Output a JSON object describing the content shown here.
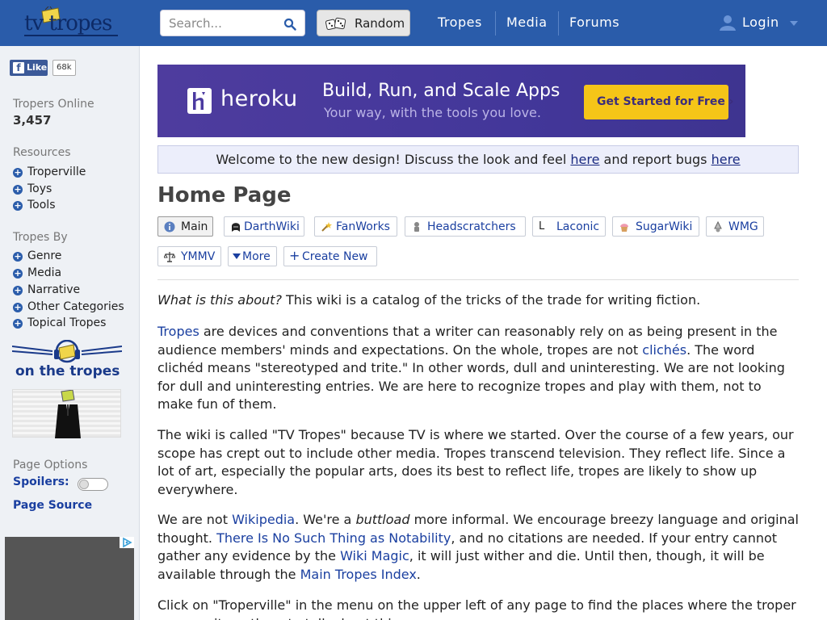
{
  "header": {
    "logo_text": "tv tropes",
    "search_placeholder": "Search...",
    "random_label": "Random",
    "nav": [
      "Tropes",
      "Media",
      "Forums"
    ],
    "login_label": "Login",
    "colors": {
      "bar": "#2a5caa",
      "link": "#1a3fa0"
    }
  },
  "sidebar": {
    "fb_like_label": "Like",
    "fb_like_count": "68k",
    "tropers_online_label": "Tropers Online",
    "tropers_online_count": "3,457",
    "resources_heading": "Resources",
    "resources": [
      "Troperville",
      "Toys",
      "Tools"
    ],
    "tropes_by_heading": "Tropes By",
    "tropes_by": [
      "Genre",
      "Media",
      "Narrative",
      "Other Categories",
      "Topical Tropes"
    ],
    "ontropes_text": "on the tropes",
    "page_options_heading": "Page Options",
    "spoilers_label": "Spoilers:",
    "page_source_label": "Page Source"
  },
  "ad": {
    "brand": "heroku",
    "tagline": "Build, Run, and Scale Apps",
    "subtagline": "Your way, with the tools you love.",
    "cta": "Get Started for Free ›"
  },
  "welcome": {
    "before": "Welcome to the new design! Discuss the look and feel ",
    "link1": "here",
    "middle": " and report bugs ",
    "link2": "here"
  },
  "page_title": "Home Page",
  "tabs": [
    {
      "label": "Main",
      "icon": "info-icon"
    },
    {
      "label": "DarthWiki",
      "icon": "darth-helmet-icon"
    },
    {
      "label": "FanWorks",
      "icon": "wand-icon"
    },
    {
      "label": "Headscratchers",
      "icon": "thinker-icon"
    },
    {
      "label": "Laconic",
      "icon": "letter-l-icon"
    },
    {
      "label": "SugarWiki",
      "icon": "cupcake-icon"
    },
    {
      "label": "WMG",
      "icon": "tinfoil-hat-icon"
    },
    {
      "label": "YMMV",
      "icon": "scales-icon"
    },
    {
      "label": "More",
      "icon": "caret-down-icon"
    },
    {
      "label": "Create New",
      "icon": "plus-icon"
    }
  ],
  "content": {
    "p1_em": "What is this about?",
    "p1_rest": " This wiki is a catalog of the tricks of the trade for writing fiction.",
    "p2_link1": "Tropes",
    "p2_a": " are devices and conventions that a writer can reasonably rely on as being present in the audience members' minds and expectations. On the whole, tropes are not ",
    "p2_link2": "clichés",
    "p2_b": ". The word clichéd means \"stereotyped and trite.\" In other words, dull and uninteresting. We are not looking for dull and uninteresting entries. We are here to recognize tropes and play with them, not to make fun of them.",
    "p3": "The wiki is called \"TV Tropes\" because TV is where we started. Over the course of a few years, our scope has crept out to include other media. Tropes transcend television. They reflect life. Since a lot of art, especially the popular arts, does its best to reflect life, tropes are likely to show up everywhere.",
    "p4_a": "We are not ",
    "p4_link1": "Wikipedia",
    "p4_b": ". We're a ",
    "p4_em": "buttload",
    "p4_c": " more informal. We encourage breezy language and original thought. ",
    "p4_link2": "There Is No Such Thing as Notability",
    "p4_d": ", and no citations are needed. If your entry cannot gather any evidence by the ",
    "p4_link3": "Wiki Magic",
    "p4_e": ", it will just wither and die. Until then, though, it will be available through the ",
    "p4_link4": "Main Tropes Index",
    "p4_f": ".",
    "p5": "Click on \"Troperville\" in the menu on the upper left of any page to find the places where the troper community gathers to talk about things."
  }
}
